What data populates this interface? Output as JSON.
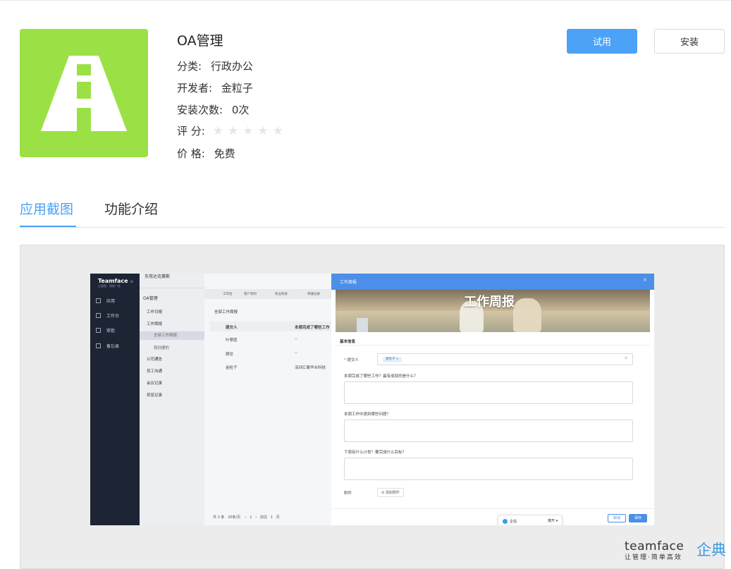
{
  "app": {
    "title": "OA管理",
    "category_label": "分类:",
    "category_value": "行政办公",
    "developer_label": "开发者:",
    "developer_value": "金粒子",
    "installs_label": "安装次数:",
    "installs_value": "0次",
    "rating_label": "评 分:",
    "rating_value": 0,
    "rating_max": 5,
    "price_label": "价 格:",
    "price_value": "免费",
    "icon": "road-icon",
    "icon_color": "#9be146"
  },
  "actions": {
    "try_label": "试用",
    "install_label": "安装",
    "accent": "#4ba2f6"
  },
  "tabs": [
    {
      "label": "应用截图",
      "active": true
    },
    {
      "label": "功能介绍",
      "active": false
    }
  ],
  "screenshot": {
    "brand": "Teamface",
    "brand_sub": "让管理 · 高效一些",
    "company": "东莞达克赛斯",
    "nav": [
      "应用",
      "工作台",
      "审批",
      "备忘录"
    ],
    "module": "OA管理",
    "menu": [
      "工作日报",
      "工作周报",
      "全部工作周报",
      "我创建的",
      "公司通告",
      "员工沟通",
      "会议记录",
      "奖惩记录"
    ],
    "inner_tabs": [
      "工作台",
      "客户资料",
      "商业机会",
      "待通记录"
    ],
    "list_title": "全部工作周报",
    "col_submitter": "提交人",
    "col_question": "本周完成了哪些工作",
    "rows": [
      {
        "name": "叶翠庭",
        "value": "--"
      },
      {
        "name": "顾总",
        "value": "--"
      },
      {
        "name": "金粒子",
        "value": "深圳汇聚华众科技"
      }
    ],
    "pager": "共 3 条   20条/页    ‹   1   ›   前往   1   页",
    "modal": {
      "title": "工作周报",
      "close": "×",
      "banner_text": "工作周报",
      "section": "基本信息",
      "submitter_label": "提交人",
      "submitter_tag": "金粒子 ×",
      "q1": "本周完成了哪些工作？最有成就的是什么？",
      "q2": "本周工作中遇到哪些问题？",
      "q3": "下周有什么计划？要完成什么目标？",
      "attach_label": "附件",
      "attach_button": "⊘ 添加附件",
      "cancel": "取消",
      "save": "保存",
      "chat_name": "企信",
      "chat_status": "离开 ▾"
    }
  },
  "watermark": {
    "brand": "teamface",
    "cn": "企典",
    "slogan": "让管理·简单高效"
  }
}
